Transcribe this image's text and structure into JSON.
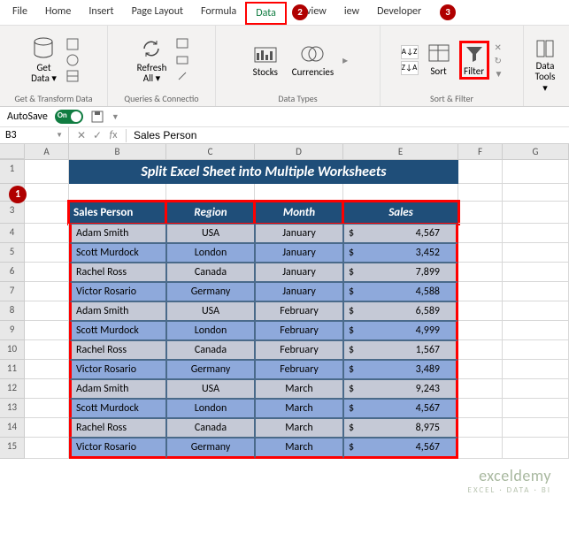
{
  "tabs": {
    "file": "File",
    "home": "Home",
    "insert": "Insert",
    "pagelayout": "Page Layout",
    "formulas": "Formula",
    "data": "Data",
    "review": "Review",
    "view": "iew",
    "developer": "Developer"
  },
  "callouts": {
    "c1": "1",
    "c2": "2",
    "c3": "3"
  },
  "ribbon": {
    "get_transform": {
      "getdata": "Get\nData ▾",
      "group": "Get & Transform Data"
    },
    "queries": {
      "refresh": "Refresh\nAll ▾",
      "group": "Queries & Connectio"
    },
    "datatypes": {
      "stocks": "Stocks",
      "currencies": "Currencies",
      "group": "Data Types"
    },
    "sortfilter": {
      "sort": "Sort",
      "filter": "Filter",
      "group": "Sort & Filter",
      "az": "A↓Z",
      "za": "Z↓A"
    },
    "datatools": {
      "tools": "Data\nTools ▾"
    }
  },
  "autosave": {
    "label": "AutoSave",
    "state": "On"
  },
  "namebox": "B3",
  "formula": "Sales Person",
  "columns": [
    "",
    "A",
    "B",
    "C",
    "D",
    "E",
    "F",
    "G"
  ],
  "banner": "Split Excel Sheet into Multiple Worksheets",
  "headers": {
    "person": "Sales Person",
    "region": "Region",
    "month": "Month",
    "sales": "Sales"
  },
  "chart_data": {
    "type": "table",
    "title": "Split Excel Sheet into Multiple Worksheets",
    "columns": [
      "Sales Person",
      "Region",
      "Month",
      "Sales"
    ],
    "rows": [
      {
        "person": "Adam Smith",
        "region": "USA",
        "month": "January",
        "sales": 4567,
        "sales_fmt": "4,567"
      },
      {
        "person": "Scott Murdock",
        "region": "London",
        "month": "January",
        "sales": 3452,
        "sales_fmt": "3,452"
      },
      {
        "person": "Rachel Ross",
        "region": "Canada",
        "month": "January",
        "sales": 7899,
        "sales_fmt": "7,899"
      },
      {
        "person": "Victor Rosario",
        "region": "Germany",
        "month": "January",
        "sales": 4588,
        "sales_fmt": "4,588"
      },
      {
        "person": "Adam Smith",
        "region": "USA",
        "month": "February",
        "sales": 6589,
        "sales_fmt": "6,589"
      },
      {
        "person": "Scott Murdock",
        "region": "London",
        "month": "February",
        "sales": 4999,
        "sales_fmt": "4,999"
      },
      {
        "person": "Rachel Ross",
        "region": "Canada",
        "month": "February",
        "sales": 1567,
        "sales_fmt": "1,567"
      },
      {
        "person": "Victor Rosario",
        "region": "Germany",
        "month": "February",
        "sales": 3489,
        "sales_fmt": "3,489"
      },
      {
        "person": "Adam Smith",
        "region": "USA",
        "month": "March",
        "sales": 9243,
        "sales_fmt": "9,243"
      },
      {
        "person": "Scott Murdock",
        "region": "London",
        "month": "March",
        "sales": 4567,
        "sales_fmt": "4,567"
      },
      {
        "person": "Rachel Ross",
        "region": "Canada",
        "month": "March",
        "sales": 8975,
        "sales_fmt": "8,975"
      },
      {
        "person": "Victor Rosario",
        "region": "Germany",
        "month": "March",
        "sales": 4567,
        "sales_fmt": "4,567"
      }
    ]
  },
  "currency": "$",
  "watermark": {
    "brand": "exceldemy",
    "tag": "EXCEL · DATA · BI"
  }
}
